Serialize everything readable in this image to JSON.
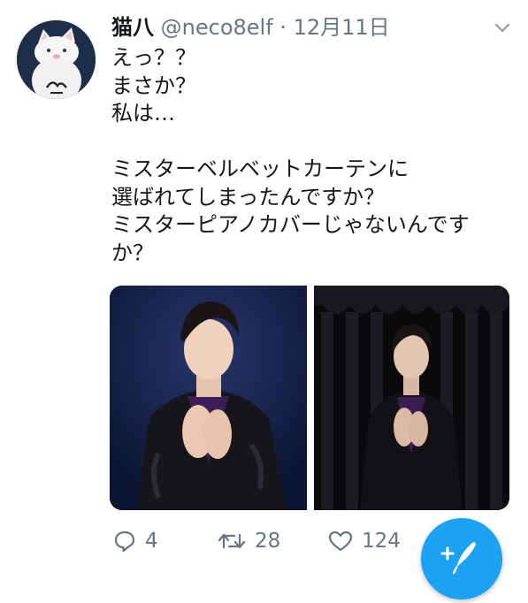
{
  "user": {
    "display_name": "猫八",
    "handle": "@neco8elf",
    "separator": "·",
    "date": "12月11日"
  },
  "tweet": {
    "lines": [
      "えっ？？",
      "まさか？",
      "私は…",
      "",
      "ミスターベルベットカーテンに",
      "選ばれてしまったんですか？",
      "ミスターピアノカバーじゃないんです",
      "か？"
    ]
  },
  "actions": {
    "reply_count": "4",
    "retweet_count": "28",
    "like_count": "124"
  },
  "colors": {
    "text": "#14171a",
    "muted": "#657786",
    "accent": "#1da1f2",
    "avatar_bg": "#1c2e4a"
  },
  "icons": {
    "reply": "reply-icon",
    "retweet": "retweet-icon",
    "like": "heart-icon",
    "compose": "compose-icon",
    "menu": "chevron-down-icon"
  }
}
